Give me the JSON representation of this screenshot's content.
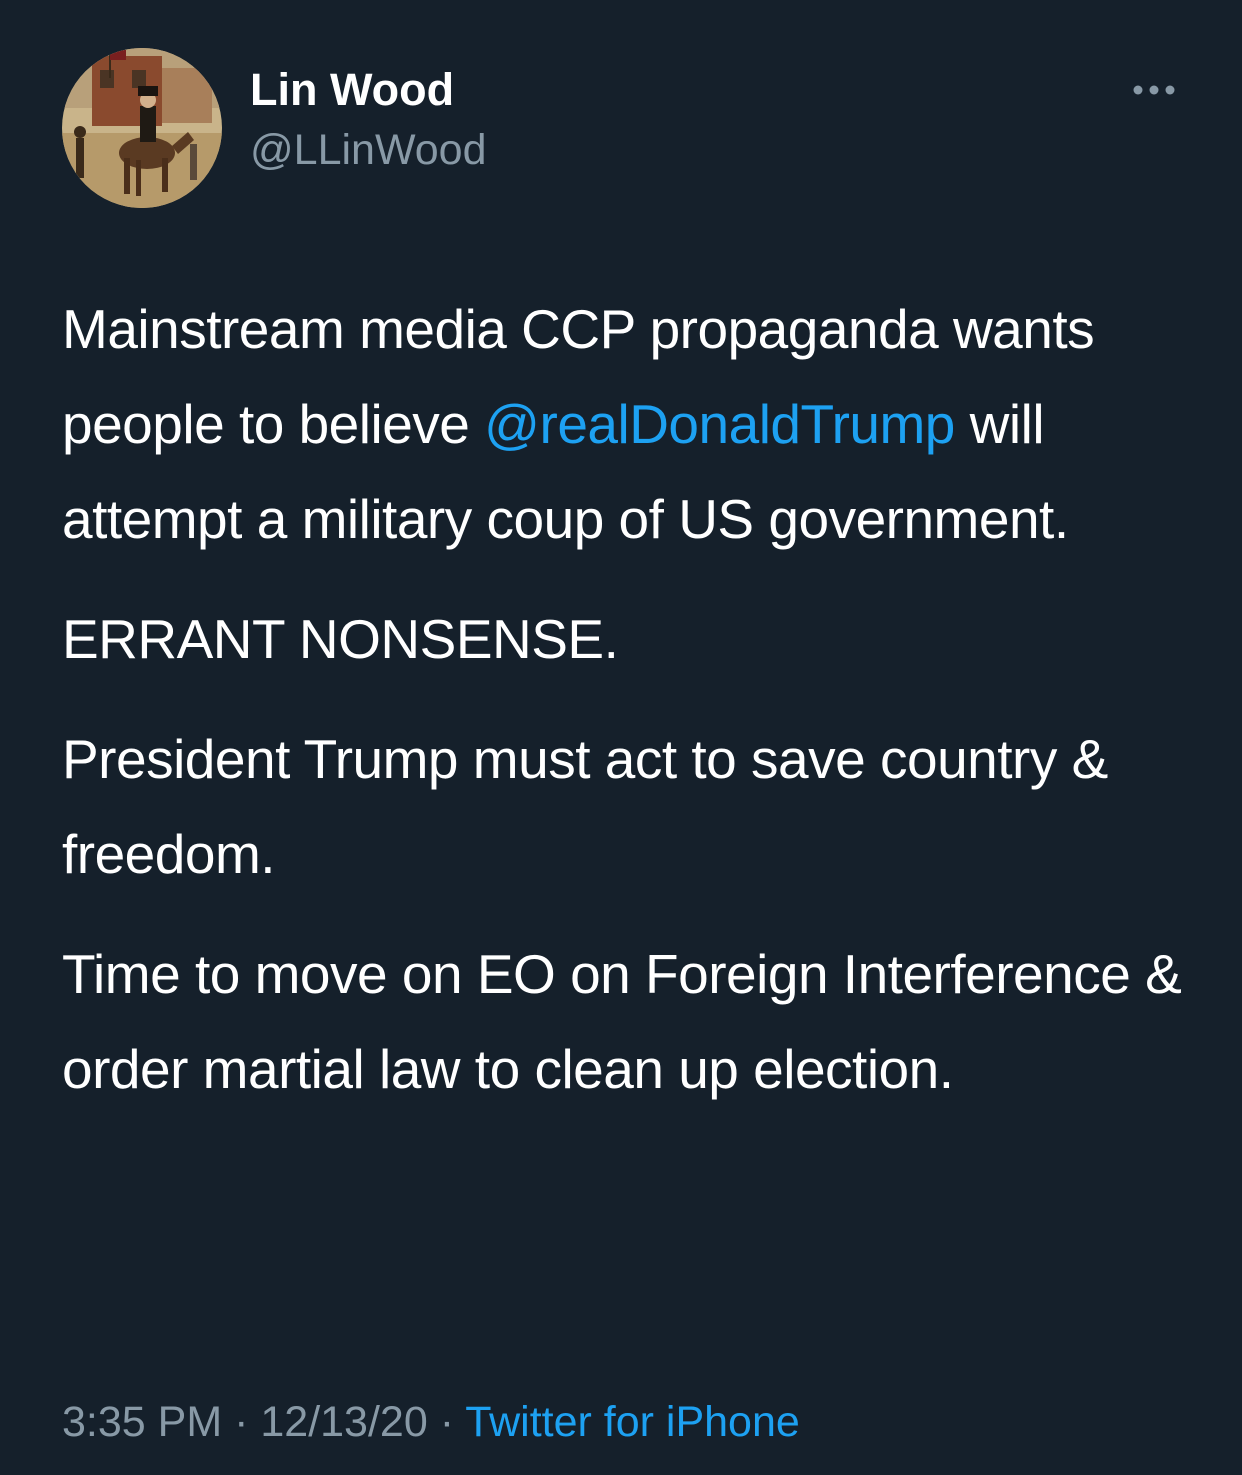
{
  "author": {
    "display_name": "Lin Wood",
    "handle": "@LLinWood",
    "avatar_icon": "avatar-painting-horse-rider"
  },
  "more_icon": "more-horizontal-icon",
  "tweet": {
    "para1_before": "Mainstream media CCP propaganda wants people to believe ",
    "mention": "@realDonaldTrump",
    "para1_after": " will attempt a military coup of US government.",
    "para2": "ERRANT NONSENSE.",
    "para3": "President Trump must act to save country & freedom.",
    "para4": "Time to move on EO on Foreign Interference & order martial law to clean up election."
  },
  "meta": {
    "time": "3:35 PM",
    "separator": " · ",
    "date": "12/13/20",
    "source": "Twitter for iPhone"
  },
  "colors": {
    "background": "#15202b",
    "text": "#ffffff",
    "secondary": "#8899a6",
    "accent": "#1da1f2"
  }
}
